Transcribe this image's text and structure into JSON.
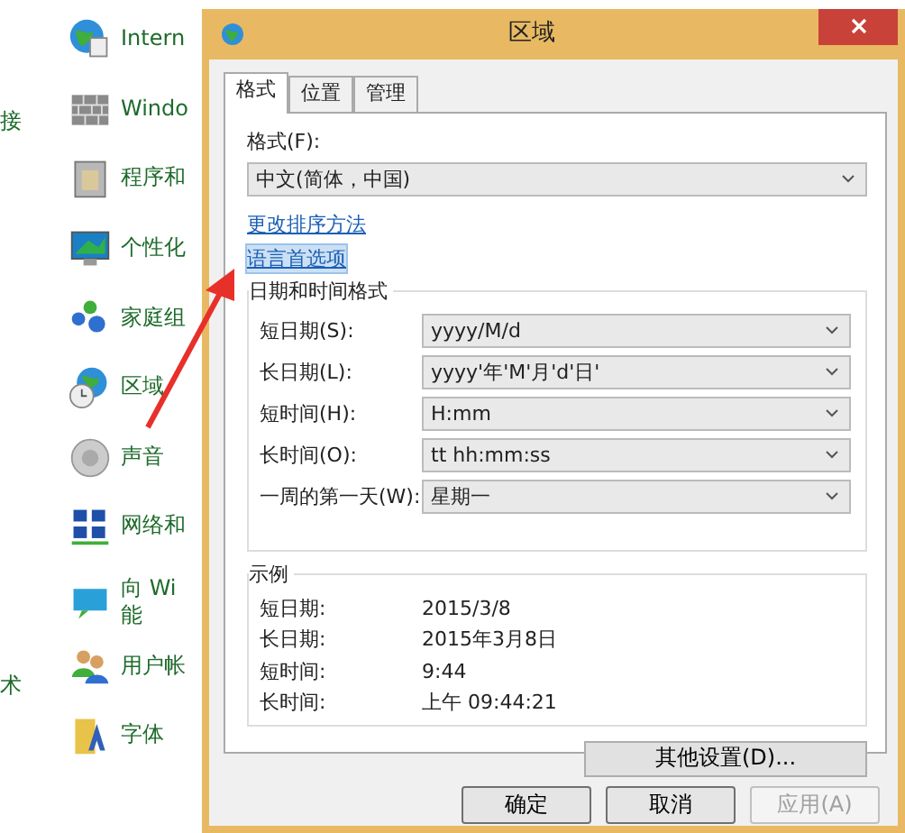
{
  "control_panel": {
    "side_labels": [
      {
        "text": "接"
      },
      {
        "text": "术"
      }
    ],
    "items": [
      {
        "label": "Intern"
      },
      {
        "label": "Windo"
      },
      {
        "label": "程序和"
      },
      {
        "label": "个性化"
      },
      {
        "label": "家庭组"
      },
      {
        "label": "区域"
      },
      {
        "label": "声音"
      },
      {
        "label": "网络和"
      },
      {
        "label": "向 Wi",
        "label_2": "能"
      },
      {
        "label": "用户帐"
      },
      {
        "label": "字体"
      }
    ]
  },
  "dialog": {
    "title": "区域",
    "tabs": [
      {
        "label": "格式",
        "selected": true
      },
      {
        "label": "位置",
        "selected": false
      },
      {
        "label": "管理",
        "selected": false
      }
    ],
    "format_label": "格式(F):",
    "format_value": "中文(简体，中国)",
    "links": [
      {
        "text": "更改排序方法",
        "highlighted": false
      },
      {
        "text": "语言首选项",
        "highlighted": true
      }
    ],
    "datetime_group": {
      "title": "日期和时间格式",
      "rows": [
        {
          "label": "短日期(S):",
          "value": "yyyy/M/d"
        },
        {
          "label": "长日期(L):",
          "value": "yyyy'年'M'月'd'日'"
        },
        {
          "label": "短时间(H):",
          "value": "H:mm"
        },
        {
          "label": "长时间(O):",
          "value": "tt hh:mm:ss"
        },
        {
          "label": "一周的第一天(W):",
          "value": "星期一"
        }
      ]
    },
    "example_group": {
      "title": "示例",
      "rows": [
        {
          "label": "短日期:",
          "value": "2015/3/8"
        },
        {
          "label": "长日期:",
          "value": "2015年3月8日"
        },
        {
          "label": "短时间:",
          "value": "9:44"
        },
        {
          "label": "长时间:",
          "value": "上午 09:44:21"
        }
      ]
    },
    "more_button": "其他设置(D)...",
    "buttons": [
      {
        "label": "确定",
        "disabled": false
      },
      {
        "label": "取消",
        "disabled": false
      },
      {
        "label": "应用(A)",
        "disabled": true
      }
    ]
  }
}
